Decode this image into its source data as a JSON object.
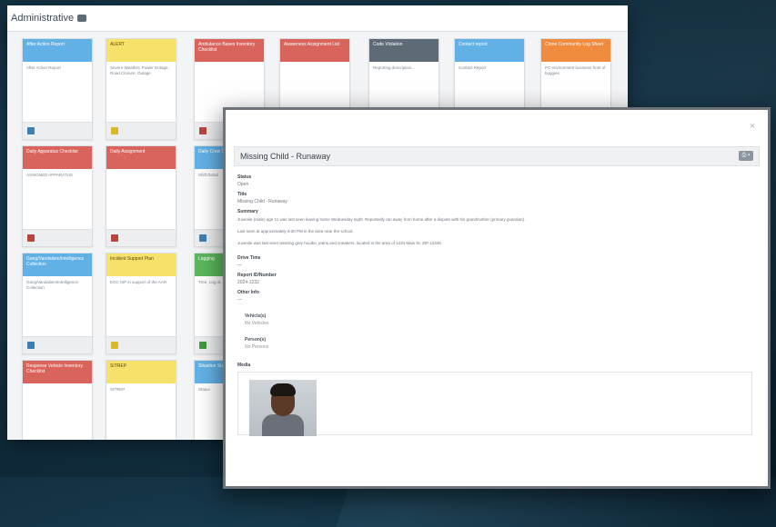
{
  "back_window": {
    "title": "Administrative",
    "cards": [
      {
        "title": "After Action Report",
        "body": "After Action Report",
        "color": "#62b1e6",
        "dark": false,
        "icon": "#3d7fb4"
      },
      {
        "title": "ALERT",
        "body": "Severe Weather, Power Outage, Road Closure, Outage",
        "color": "#f6e16a",
        "dark": true,
        "icon": "#d8b928"
      },
      {
        "title": "Ambulance Bases Inventory Checklist",
        "body": "",
        "color": "#d9645c",
        "dark": false,
        "icon": "#b84640"
      },
      {
        "title": "Awareness Assignment List",
        "body": "",
        "color": "#d9645c",
        "dark": false,
        "icon": "#b84640"
      },
      {
        "title": "Code Violation",
        "body": "Reporting description...",
        "color": "#5e6b77",
        "dark": false,
        "icon": "#48545f"
      },
      {
        "title": "Contact report",
        "body": "Contact Report",
        "color": "#62b1e6",
        "dark": false,
        "icon": "#3d7fb4"
      },
      {
        "title": "Crime Community Log Sheet",
        "body": "PC environment business front of buggies",
        "color": "#f08a3c",
        "dark": false,
        "icon": "#c96a22"
      },
      {
        "title": "Daily Apparatus Checklist",
        "body": "ASSIGNED APPARATUS",
        "color": "#d9645c",
        "dark": false,
        "icon": "#b84640"
      },
      {
        "title": "Daily Assignment",
        "body": "",
        "color": "#d9645c",
        "dark": false,
        "icon": "#b84640"
      },
      {
        "title": "Daily Crew Schedule",
        "body": "Shift Detail",
        "color": "#62b1e6",
        "dark": false,
        "icon": "#3d7fb4"
      },
      {
        "title": "Gang/Vandalism/Intelligence Collection",
        "body": "Gang/Vandalism/Intelligence Collection",
        "color": "#62b1e6",
        "dark": false,
        "icon": "#3d7fb4"
      },
      {
        "title": "Incident Support Plan",
        "body": "EOC ISP in support of the AAR",
        "color": "#f6e16a",
        "dark": true,
        "icon": "#d8b928"
      },
      {
        "title": "Logging",
        "body": "Tree, Log of...",
        "color": "#5cb85c",
        "dark": false,
        "icon": "#3f9a3f"
      },
      {
        "title": "Response Vehicle Inventory Checklist",
        "body": "",
        "color": "#d9645c",
        "dark": false,
        "icon": "#b84640"
      },
      {
        "title": "SITREP",
        "body": "SITREP",
        "color": "#f6e16a",
        "dark": true,
        "icon": "#d8b928"
      },
      {
        "title": "Situation Status",
        "body": "Status",
        "color": "#62b1e6",
        "dark": false,
        "icon": "#3d7fb4"
      }
    ]
  },
  "modal": {
    "close_glyph": "×",
    "header_title": "Missing Child - Runaway",
    "header_button": "⎙ ▾",
    "fields": [
      {
        "label": "Status",
        "value": "Open"
      },
      {
        "label": "Title",
        "value": "Missing Child - Runaway"
      }
    ],
    "summary": {
      "label": "Summary",
      "paragraphs": [
        "Juvenile (male) age 11 was last seen leaving home Wednesday night. Reportedly ran away from home after a dispute with his grandmother (primary guardian).",
        "Last seen at approximately 8:30 PM in the area near the school.",
        "Juvenile was last seen wearing grey hoodie, jeans and sneakers, located in the area of 1234 Main St, ZIP 12345."
      ]
    },
    "fields2": [
      {
        "label": "Drive Time",
        "value": "—"
      },
      {
        "label": "Report ID/Number",
        "value": "2024-1232"
      },
      {
        "label": "Other Info",
        "value": "—"
      }
    ],
    "vehicle": {
      "label": "Vehicle(s)",
      "value": "No Vehicles"
    },
    "persons": {
      "label": "Person(s)",
      "value": "No Persons"
    },
    "media": {
      "label": "Media"
    }
  }
}
